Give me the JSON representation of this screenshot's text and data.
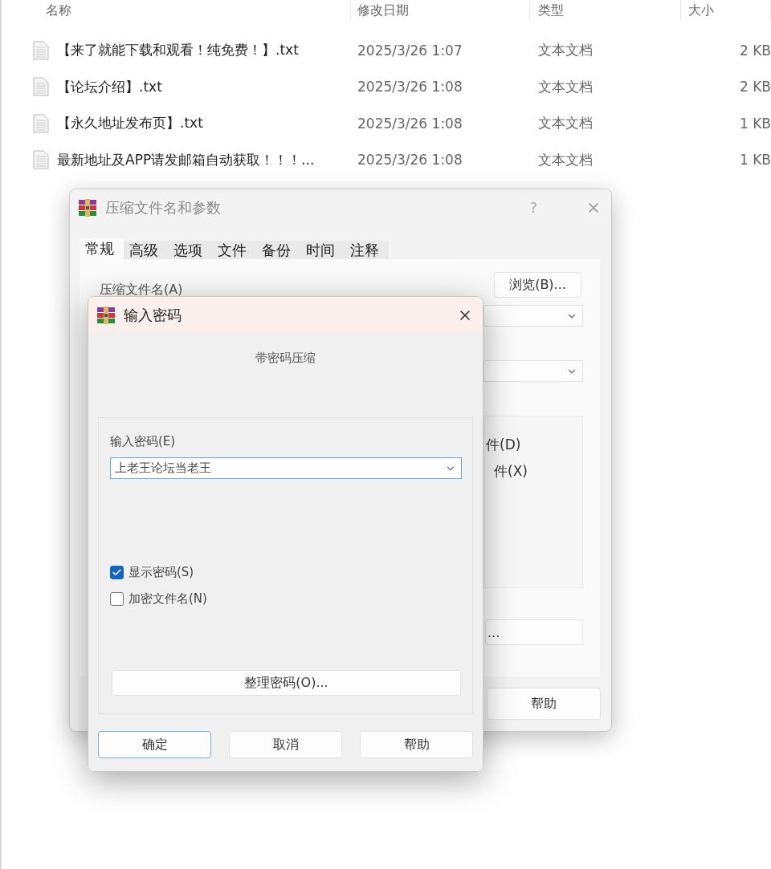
{
  "explorer": {
    "columns": [
      "名称",
      "修改日期",
      "类型",
      "大小"
    ],
    "rows": [
      {
        "name": "【来了就能下载和观看！纯免费！】.txt",
        "modified": "2025/3/26 1:07",
        "type": "文本文档",
        "size": "2 KB"
      },
      {
        "name": "【论坛介绍】.txt",
        "modified": "2025/3/26 1:08",
        "type": "文本文档",
        "size": "2 KB"
      },
      {
        "name": "【永久地址发布页】.txt",
        "modified": "2025/3/26 1:08",
        "type": "文本文档",
        "size": "1 KB"
      },
      {
        "name": "最新地址及APP请发邮箱自动获取！！！...",
        "modified": "2025/3/26 1:08",
        "type": "文本文档",
        "size": "1 KB"
      }
    ]
  },
  "archive_dialog": {
    "title": "压缩文件名和参数",
    "help_mark": "?",
    "tabs": [
      {
        "label": "常规",
        "selected": true
      },
      {
        "label": "高级",
        "selected": false
      },
      {
        "label": "选项",
        "selected": false
      },
      {
        "label": "文件",
        "selected": false
      },
      {
        "label": "备份",
        "selected": false
      },
      {
        "label": "时间",
        "selected": false
      },
      {
        "label": "注释",
        "selected": false
      }
    ],
    "archive_name_label": "压缩文件名(A)",
    "browse_button": "浏览(B)...",
    "group_options": [
      "件(D)",
      "件(X)"
    ],
    "partial_button": "...",
    "help_button": "帮助"
  },
  "password_dialog": {
    "title": "输入密码",
    "subtitle": "带密码压缩",
    "password_label": "输入密码(E)",
    "password_value": "上老王论坛当老王",
    "checkboxes": [
      {
        "label": "显示密码(S)",
        "checked": true
      },
      {
        "label": "加密文件名(N)",
        "checked": false
      }
    ],
    "organize_button": "整理密码(O)...",
    "buttons": [
      {
        "label": "确定",
        "default": true
      },
      {
        "label": "取消",
        "default": false
      },
      {
        "label": "帮助",
        "default": false
      }
    ]
  }
}
